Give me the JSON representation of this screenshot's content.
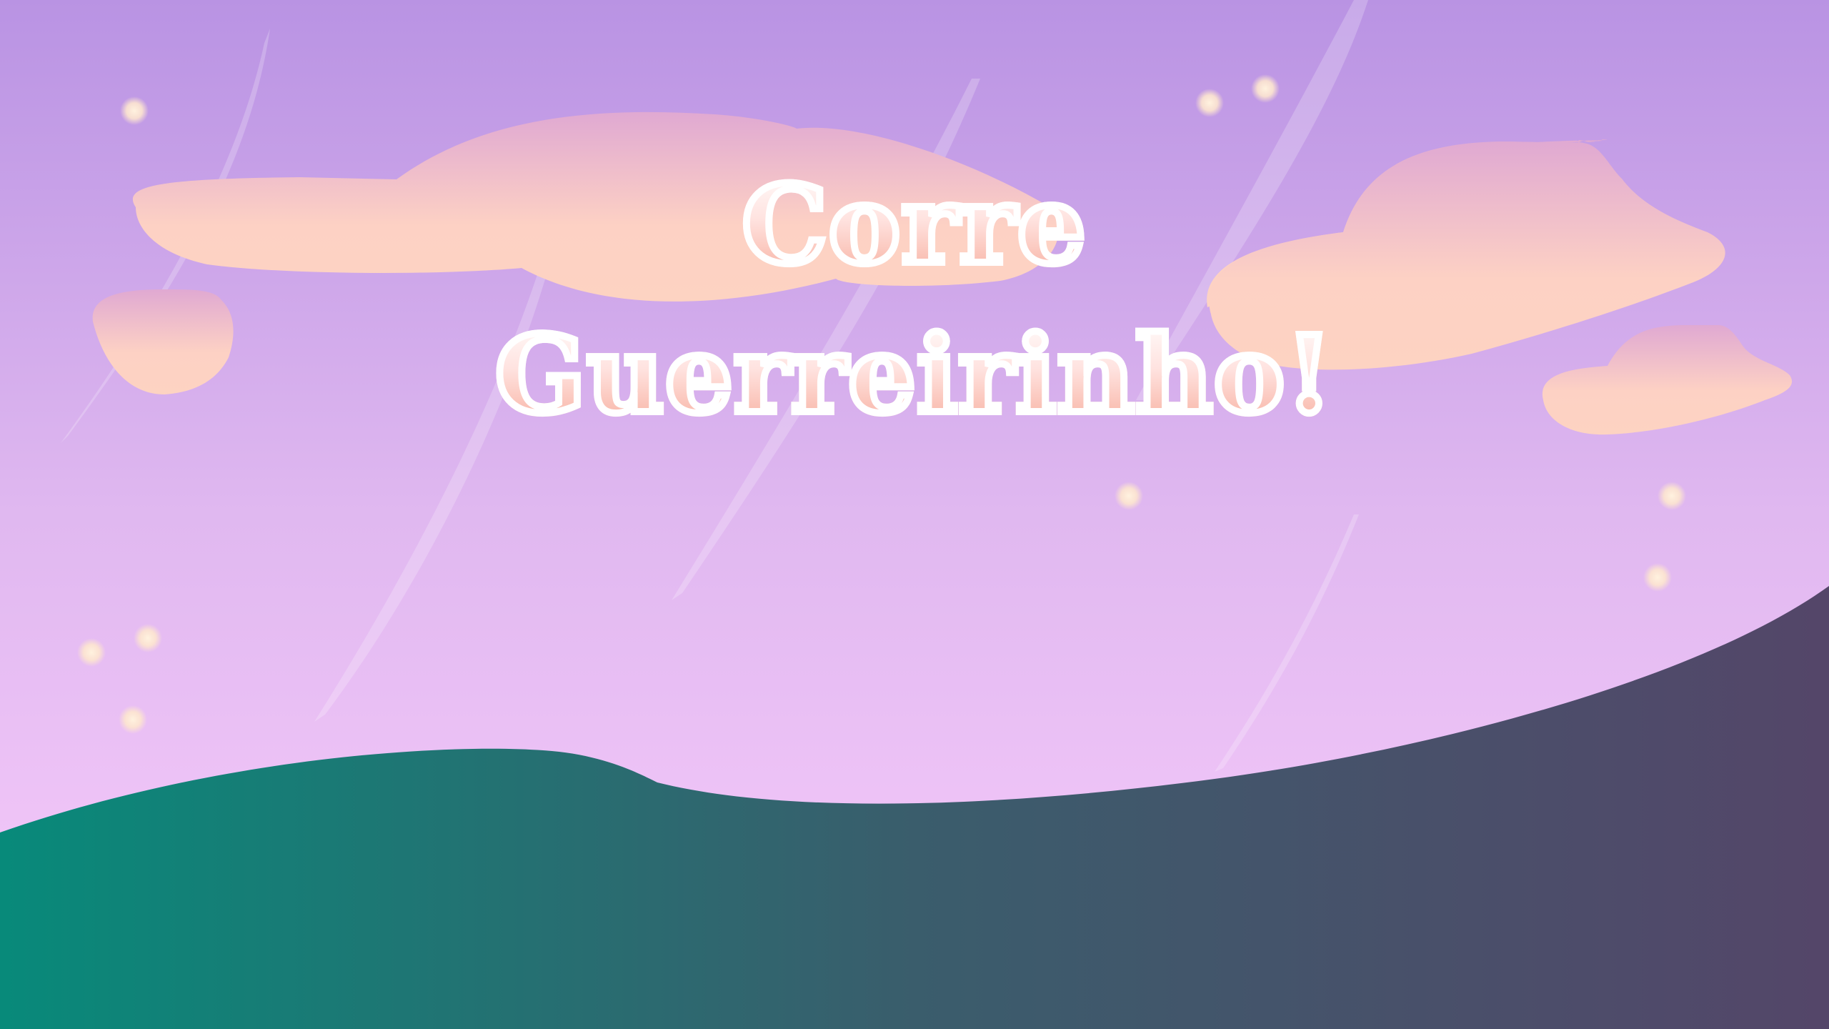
{
  "game": {
    "title_line_1": "Corre",
    "title_line_2": "Guerreirinho!"
  },
  "colors": {
    "sky_top": "#b993e3",
    "sky_bottom": "#f6c8fa",
    "cloud_top": "#e2acd0",
    "cloud_bottom": "#fdd3c2",
    "title_fill_top": "#ffffff",
    "title_fill_bottom": "#f6a896",
    "title_shadow": "#a87ac8",
    "ground_left": "#088a7a",
    "ground_right": "#544669",
    "sparkle": "#fde6cf"
  }
}
